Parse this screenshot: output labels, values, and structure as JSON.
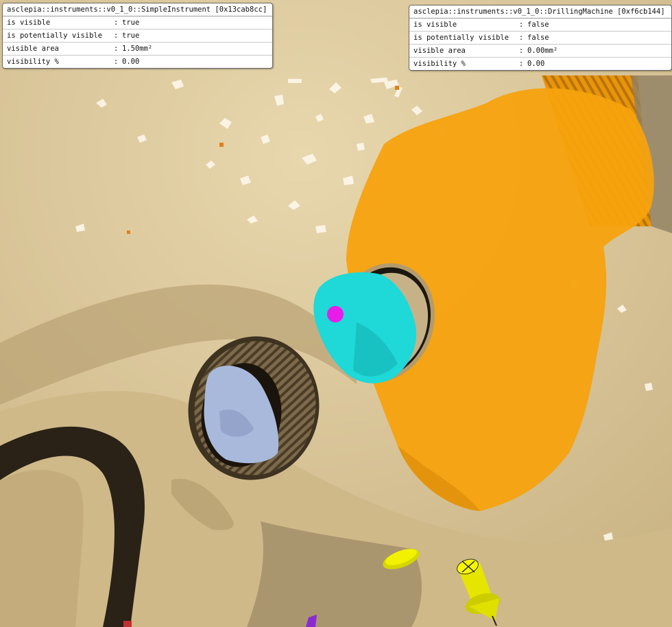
{
  "panels": {
    "left": {
      "title": "asclepia::instruments::v0_1_0::SimpleInstrument [0x13cab8cc]",
      "rows": [
        {
          "label": "is visible",
          "sep": ":",
          "value": "true"
        },
        {
          "label": "is potentially visible",
          "sep": ":",
          "value": "true"
        },
        {
          "label": "visible area",
          "sep": ":",
          "value": "1.50mm²"
        },
        {
          "label": "visibility %",
          "sep": ":",
          "value": "0.00"
        }
      ]
    },
    "right": {
      "title": "asclepia::instruments::v0_1_0::DrillingMachine [0xf6cb144]",
      "rows": [
        {
          "label": "is visible",
          "sep": ":",
          "value": "false"
        },
        {
          "label": "is potentially visible",
          "sep": ":",
          "value": "false"
        },
        {
          "label": "visible area",
          "sep": ":",
          "value": "0.00mm²"
        },
        {
          "label": "visibility %",
          "sep": ":",
          "value": "0.00"
        }
      ]
    }
  },
  "scene": {
    "colors": {
      "bone": "#d9c497",
      "bone_shadow": "#5a4a32",
      "highlight": "#fffbe8",
      "drill_region": "#f5a20e",
      "instrument_region": "#1fd8d8",
      "target_point": "#e81ce8",
      "sinus": "#a9b9dc",
      "drill_tool": "#f2f200"
    }
  }
}
